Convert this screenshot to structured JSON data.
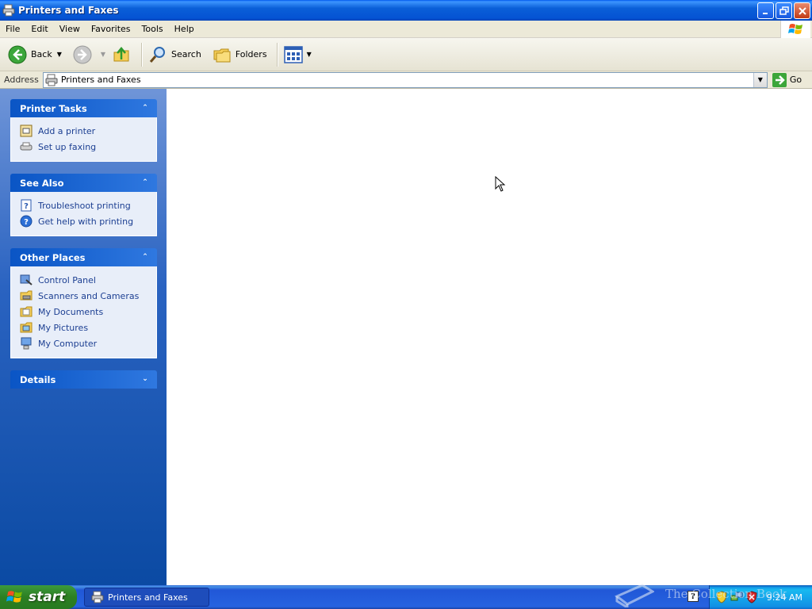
{
  "window": {
    "title": "Printers and Faxes",
    "icon": "printer-icon"
  },
  "menu": [
    "File",
    "Edit",
    "View",
    "Favorites",
    "Tools",
    "Help"
  ],
  "toolbar": {
    "back_label": "Back",
    "search_label": "Search",
    "folders_label": "Folders"
  },
  "address": {
    "label": "Address",
    "value": "Printers and Faxes",
    "go_label": "Go"
  },
  "panels": {
    "printer_tasks": {
      "title": "Printer Tasks",
      "items": [
        "Add a printer",
        "Set up faxing"
      ]
    },
    "see_also": {
      "title": "See Also",
      "items": [
        "Troubleshoot printing",
        "Get help with printing"
      ]
    },
    "other_places": {
      "title": "Other Places",
      "items": [
        "Control Panel",
        "Scanners and Cameras",
        "My Documents",
        "My Pictures",
        "My Computer"
      ]
    },
    "details": {
      "title": "Details"
    }
  },
  "taskbar": {
    "start_label": "start",
    "task_label": "Printers and Faxes",
    "clock": "9:24 AM",
    "watermark": "The Collection Book"
  },
  "colors": {
    "titlebar": "#0553d3",
    "taskpane": "#2a63c1",
    "link": "#1c3f92",
    "start": "#2c7f22"
  }
}
